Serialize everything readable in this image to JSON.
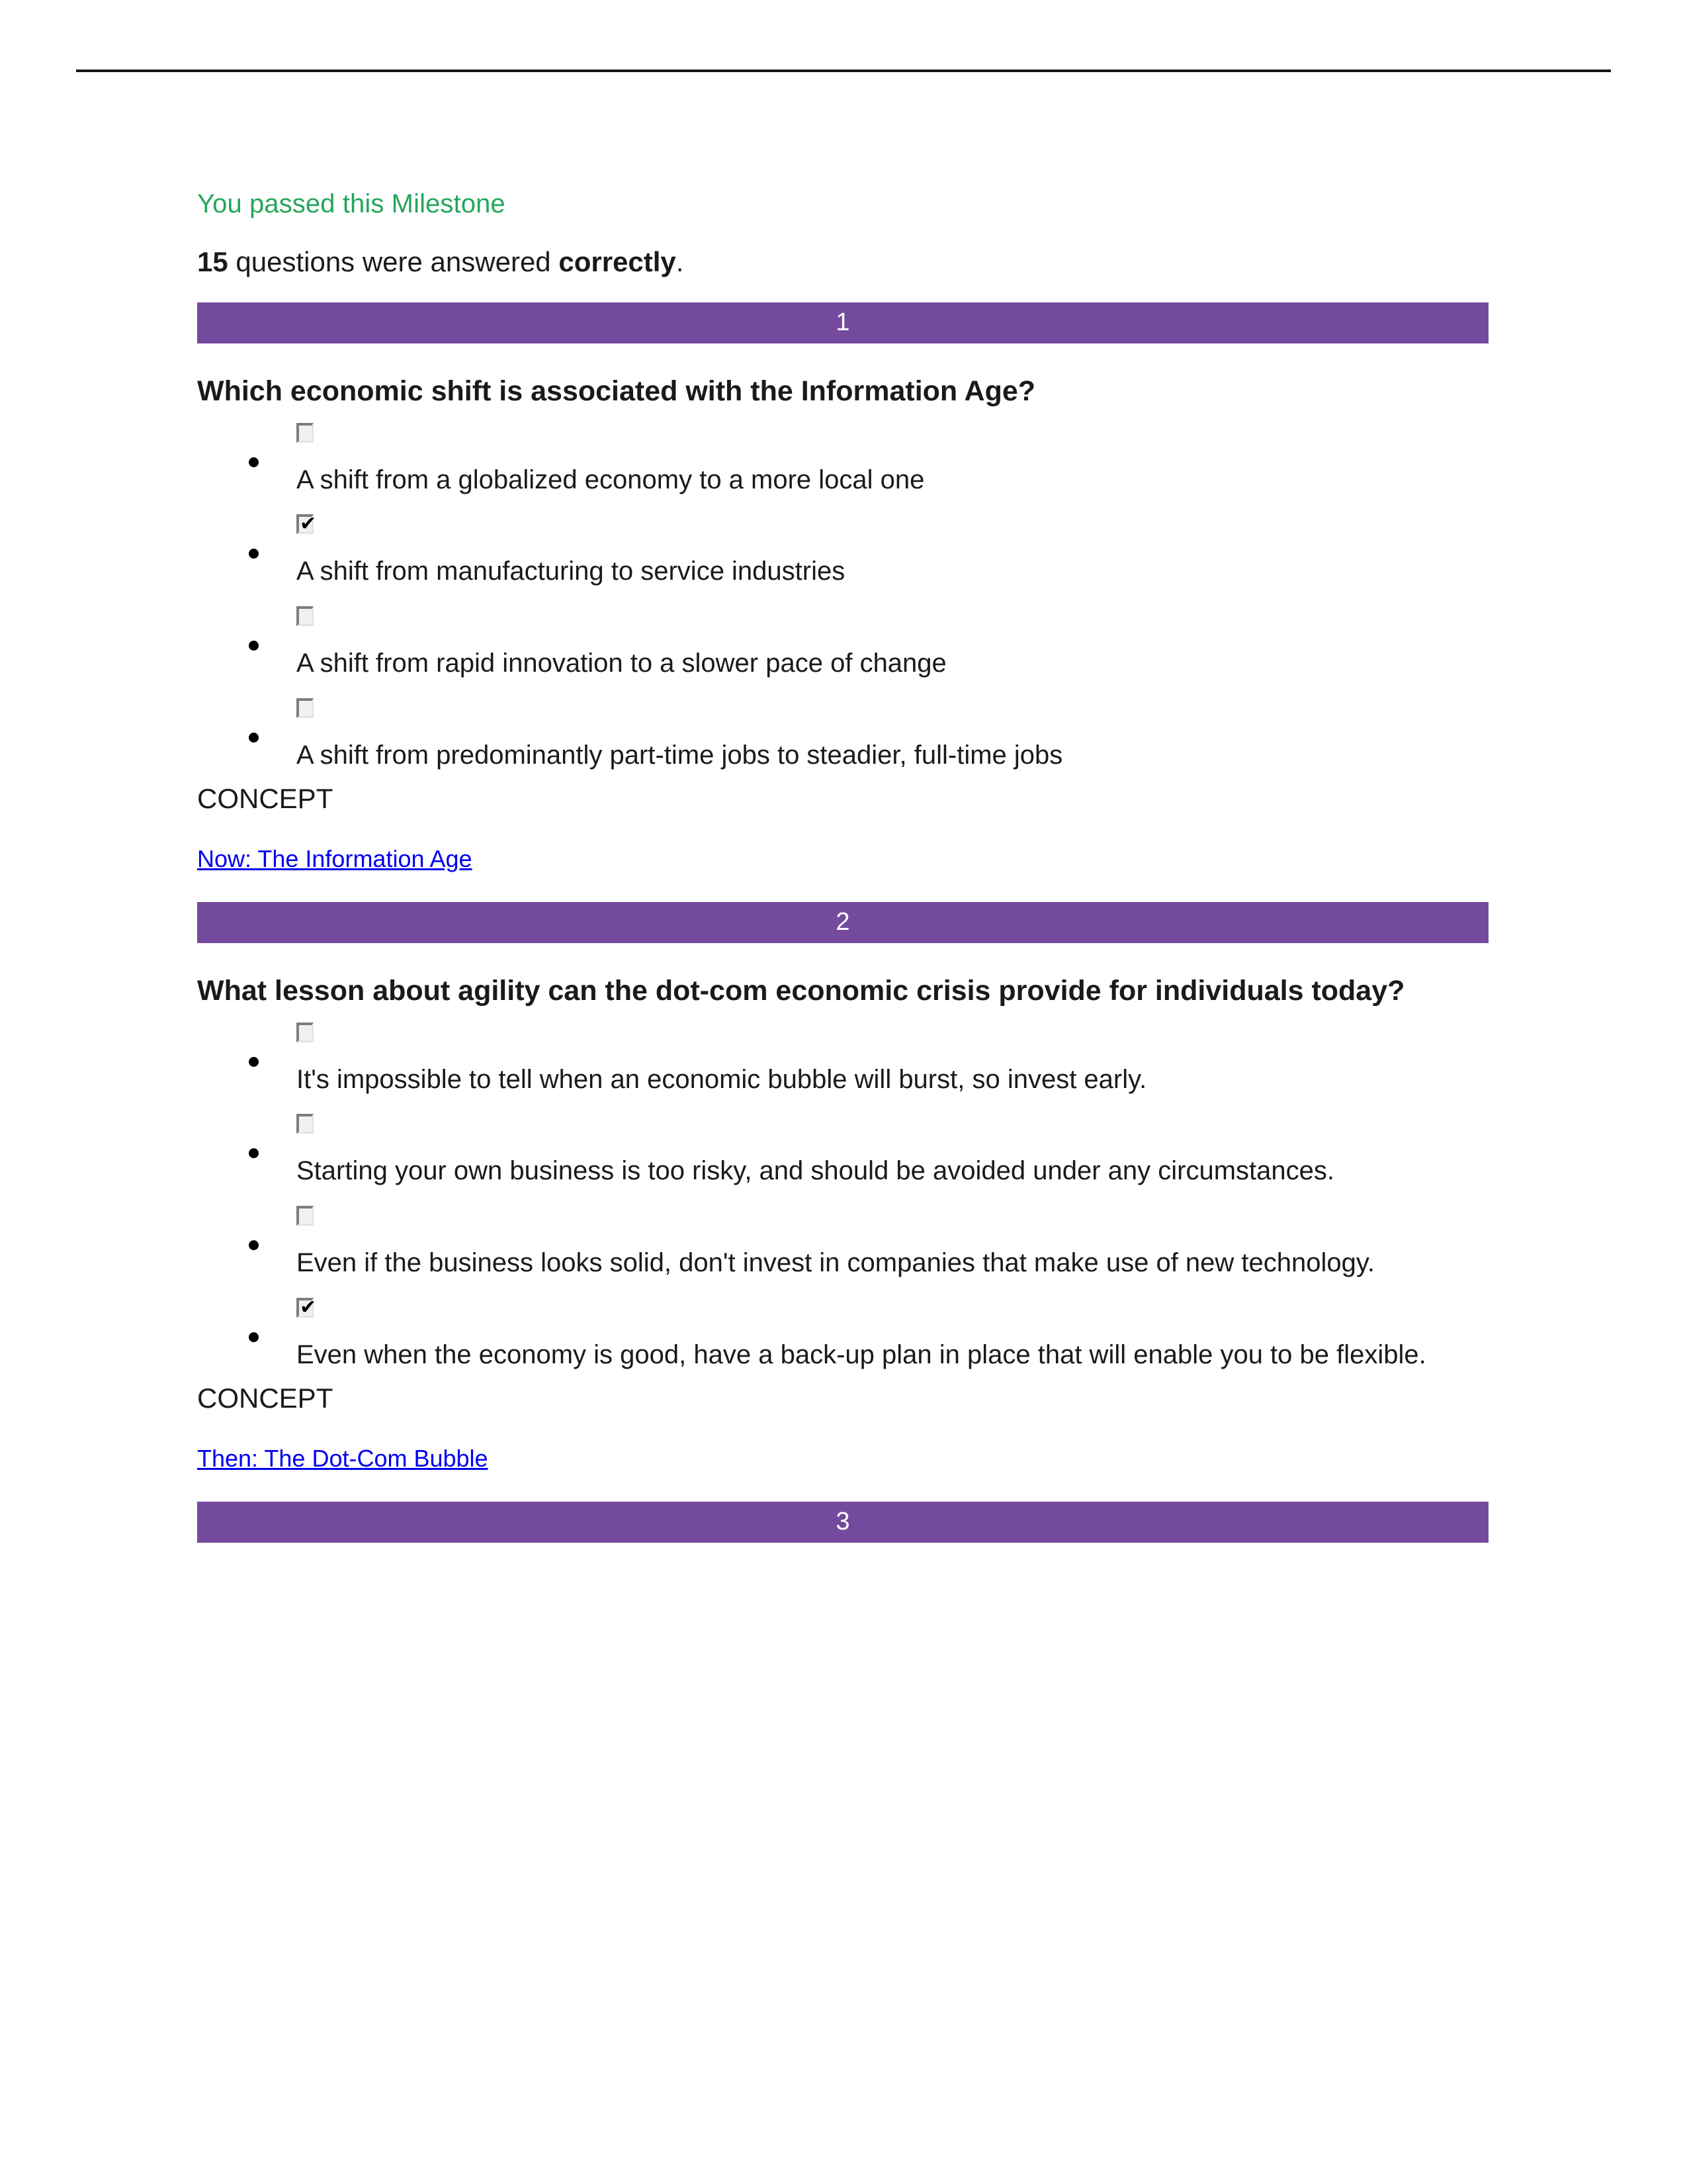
{
  "header": {
    "milestone_status": "You passed this Milestone",
    "score_count": "15",
    "score_text_before": " questions were answered ",
    "score_emphasis": "correctly",
    "score_text_after": "."
  },
  "colors": {
    "pass_green": "#26a65b",
    "question_bar_purple": "#744a9e",
    "link_blue": "#0000ee",
    "text_black": "#1a1a1a",
    "rule_black": "#151515"
  },
  "labels": {
    "concept": "CONCEPT",
    "checked_glyph": "✔"
  },
  "questions": [
    {
      "number": "1",
      "text": "Which economic shift is associated with the Information Age?",
      "options": [
        {
          "checked": false,
          "text": "A shift from a globalized economy to a more local one"
        },
        {
          "checked": true,
          "text": "A shift from manufacturing to service industries"
        },
        {
          "checked": false,
          "text": "A shift from rapid innovation to a slower pace of change"
        },
        {
          "checked": false,
          "text": "A shift from predominantly part-time jobs to steadier, full-time jobs"
        }
      ],
      "concept_label": "CONCEPT",
      "concept_link": "Now: The Information Age"
    },
    {
      "number": "2",
      "text": "What lesson about agility can the dot-com economic crisis provide for individuals today?",
      "options": [
        {
          "checked": false,
          "text": "It's impossible to tell when an economic bubble will burst, so invest early."
        },
        {
          "checked": false,
          "text": "Starting your own business is too risky, and should be avoided under any circumstances."
        },
        {
          "checked": false,
          "text": "Even if the business looks solid, don't invest in companies that make use of new technology."
        },
        {
          "checked": true,
          "text": "Even when the economy is good, have a back-up plan in place that will enable you to be flexible."
        }
      ],
      "concept_label": "CONCEPT",
      "concept_link": "Then: The Dot-Com Bubble"
    },
    {
      "number": "3",
      "text": "",
      "options": [],
      "concept_label": "",
      "concept_link": ""
    }
  ]
}
